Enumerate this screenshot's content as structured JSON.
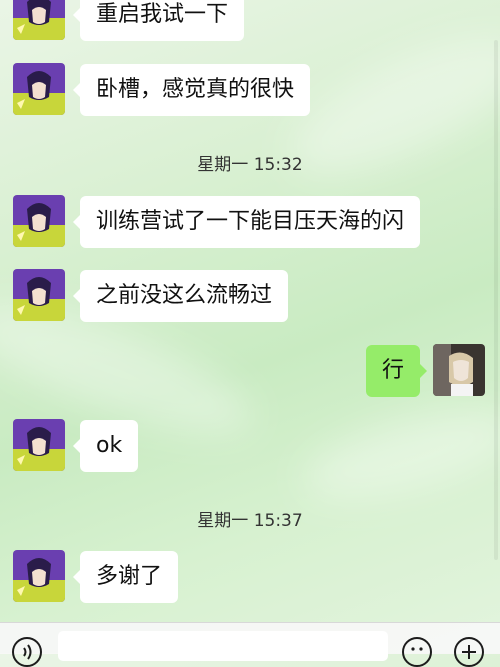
{
  "messages": [
    {
      "side": "left",
      "text": "重启我试一下"
    },
    {
      "side": "left",
      "text": "卧槽，感觉真的很快"
    },
    {
      "side": "left",
      "text": "训练营试了一下能目压天海的闪"
    },
    {
      "side": "left",
      "text": "之前没这么流畅过"
    },
    {
      "side": "right",
      "text": "行"
    },
    {
      "side": "left",
      "text": "ok"
    },
    {
      "side": "left",
      "text": "多谢了"
    }
  ],
  "timestamps": [
    "星期一 15:32",
    "星期一 15:37"
  ],
  "input_bar": {
    "icons": [
      "voice-icon",
      "emoji-icon",
      "plus-icon"
    ]
  },
  "colors": {
    "incoming_bubble": "#ffffff",
    "outgoing_bubble": "#95ec69",
    "background": "#d9f0d2"
  }
}
